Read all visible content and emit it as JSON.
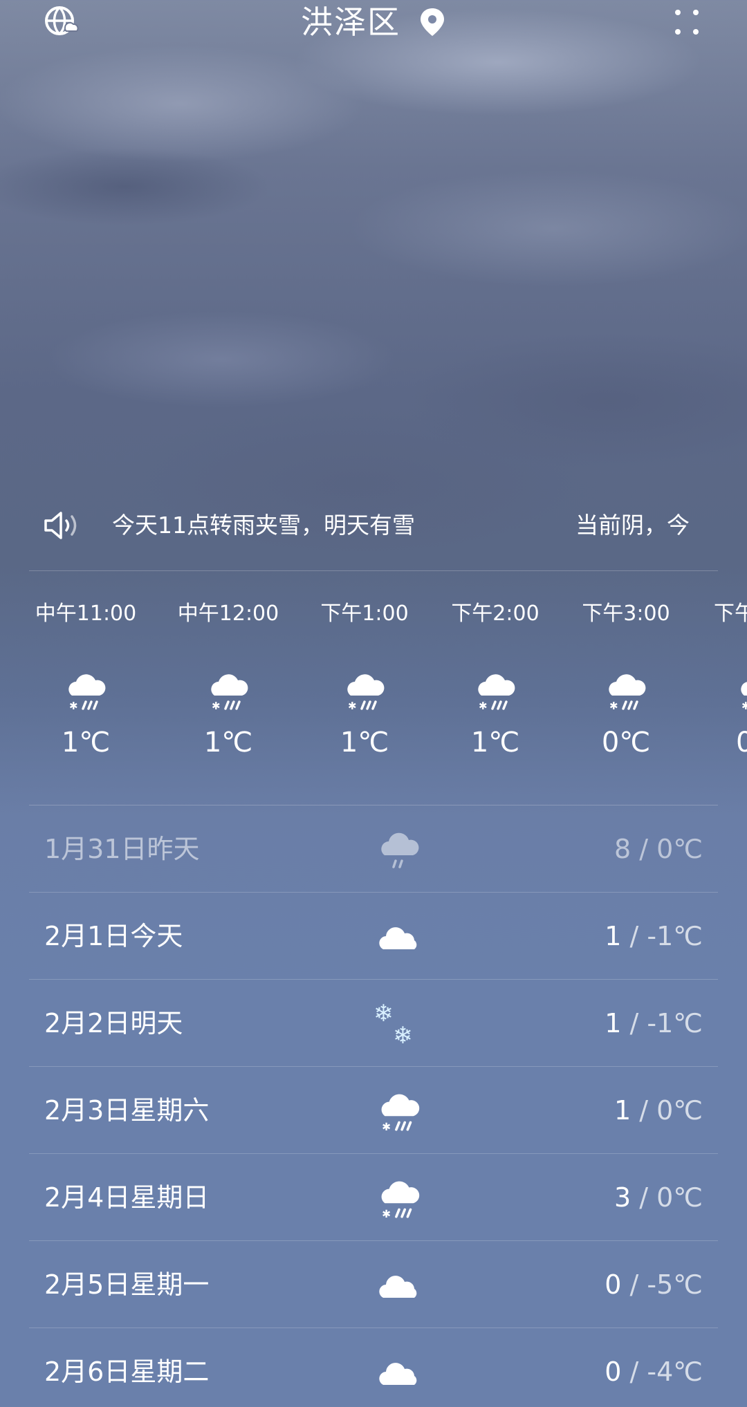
{
  "header": {
    "city": "洪泽区"
  },
  "ticker": {
    "text": "今天11点转雨夹雪，明天有雪",
    "text2": "当前阴，今"
  },
  "hourly": [
    {
      "time": "中午11:00",
      "temp": "1℃",
      "icon": "sleet-icon"
    },
    {
      "time": "中午12:00",
      "temp": "1℃",
      "icon": "sleet-icon"
    },
    {
      "time": "下午1:00",
      "temp": "1℃",
      "icon": "sleet-icon"
    },
    {
      "time": "下午2:00",
      "temp": "1℃",
      "icon": "sleet-icon"
    },
    {
      "time": "下午3:00",
      "temp": "0℃",
      "icon": "sleet-icon"
    },
    {
      "time": "下午",
      "temp": "0",
      "icon": "sleet-icon"
    }
  ],
  "daily": [
    {
      "label": "1月31日昨天",
      "high": "8",
      "low": "0℃",
      "icon": "light-rain-icon"
    },
    {
      "label": "2月1日今天",
      "high": "1",
      "low": "-1℃",
      "icon": "cloudy-icon"
    },
    {
      "label": "2月2日明天",
      "high": "1",
      "low": "-1℃",
      "icon": "snow-icon"
    },
    {
      "label": "2月3日星期六",
      "high": "1",
      "low": "0℃",
      "icon": "sleet-icon"
    },
    {
      "label": "2月4日星期日",
      "high": "3",
      "low": "0℃",
      "icon": "sleet-icon"
    },
    {
      "label": "2月5日星期一",
      "high": "0",
      "low": "-5℃",
      "icon": "cloudy-icon"
    },
    {
      "label": "2月6日星期二",
      "high": "0",
      "low": "-4℃",
      "icon": "cloudy-icon"
    }
  ],
  "separator": "/"
}
